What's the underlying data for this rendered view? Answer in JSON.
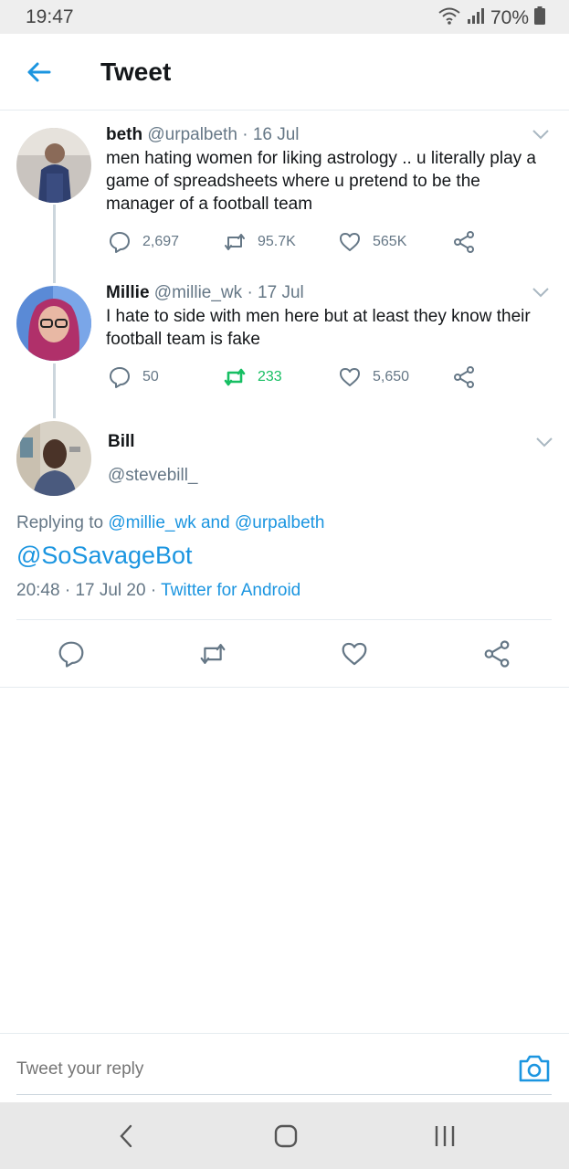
{
  "status_bar": {
    "time": "19:47",
    "battery": "70%"
  },
  "header": {
    "title": "Tweet"
  },
  "colors": {
    "accent": "#1b95e0",
    "retweet_active": "#17bf63",
    "secondary_text": "#657786"
  },
  "thread": [
    {
      "name": "beth",
      "handle": "@urpalbeth",
      "date": "16 Jul",
      "text": "men hating women for liking astrology .. u literally play a game of spreadsheets where u pretend to be the manager of a football team",
      "replies": "2,697",
      "retweets": "95.7K",
      "likes": "565K",
      "retweeted": false
    },
    {
      "name": "Millie",
      "handle": "@millie_wk",
      "date": "17 Jul",
      "text": "I hate to side with men here but at least they know their football team is fake",
      "replies": "50",
      "retweets": "233",
      "likes": "5,650",
      "retweeted": true
    }
  ],
  "main_tweet": {
    "name": "Bill",
    "handle": "@stevebill_",
    "replying_prefix": "Replying to",
    "replying_user1": "@millie_wk",
    "replying_and": "and",
    "replying_user2": "@urpalbeth",
    "text": "@SoSavageBot",
    "time": "20:48",
    "date": "17 Jul 20",
    "source": "Twitter for Android"
  },
  "reply_bar": {
    "placeholder": "Tweet your reply"
  },
  "icons": {
    "back": "arrow-left-icon",
    "reply": "comment-icon",
    "retweet": "retweet-icon",
    "like": "heart-icon",
    "share": "share-icon",
    "camera": "camera-icon"
  }
}
